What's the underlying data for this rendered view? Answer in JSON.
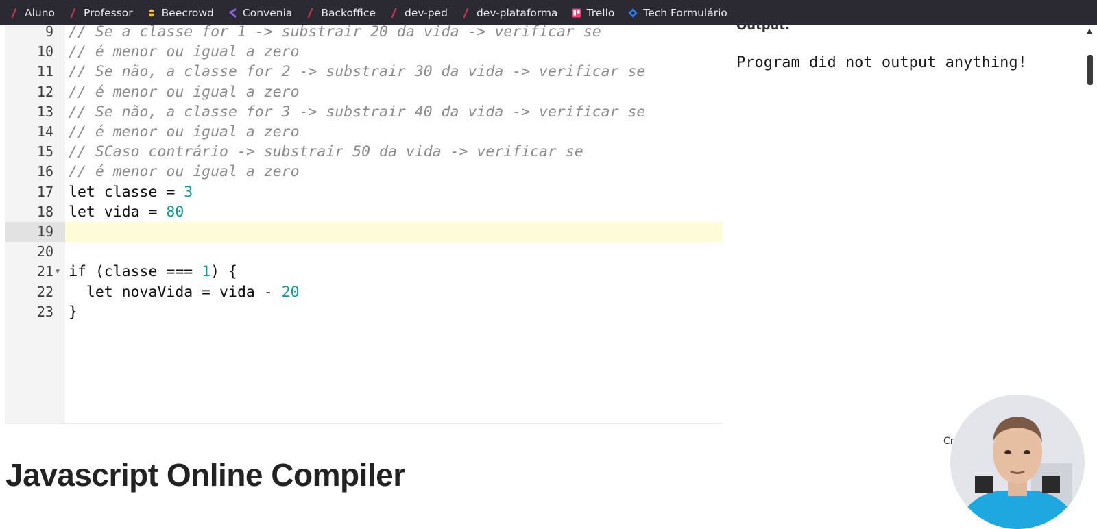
{
  "bookmarks": [
    {
      "label": "Aluno",
      "icon": "slash-icon",
      "color": "#c4374f"
    },
    {
      "label": "Professor",
      "icon": "slash-icon",
      "color": "#c4374f"
    },
    {
      "label": "Beecrowd",
      "icon": "beecrowd-icon",
      "color": "#f2c230"
    },
    {
      "label": "Convenia",
      "icon": "convenia-icon",
      "color": "#8e62d9"
    },
    {
      "label": "Backoffice",
      "icon": "slash-icon",
      "color": "#c4374f"
    },
    {
      "label": "dev-ped",
      "icon": "slash-icon",
      "color": "#c4374f"
    },
    {
      "label": "dev-plataforma",
      "icon": "slash-icon",
      "color": "#c4374f"
    },
    {
      "label": "Trello",
      "icon": "trello-icon",
      "color": "#e9457a"
    },
    {
      "label": "Tech Formulário",
      "icon": "jira-icon",
      "color": "#2684ff"
    }
  ],
  "editor": {
    "lines": [
      {
        "n": "9",
        "kind": "comment",
        "text": "// Se a classe for 1 -> substrair 20 da vida -> verificar se"
      },
      {
        "n": "10",
        "kind": "comment",
        "text": "// é menor ou igual a zero"
      },
      {
        "n": "11",
        "kind": "comment",
        "text": "// Se não, a classe for 2 -> substrair 30 da vida -> verificar se"
      },
      {
        "n": "12",
        "kind": "comment",
        "text": "// é menor ou igual a zero"
      },
      {
        "n": "13",
        "kind": "comment",
        "text": "// Se não, a classe for 3 -> substrair 40 da vida -> verificar se"
      },
      {
        "n": "14",
        "kind": "comment",
        "text": "// é menor ou igual a zero"
      },
      {
        "n": "15",
        "kind": "comment",
        "text": "// SCaso contrário -> substrair 50 da vida -> verificar se"
      },
      {
        "n": "16",
        "kind": "comment",
        "text": "// é menor ou igual a zero"
      },
      {
        "n": "17",
        "kind": "code",
        "pre": "let classe = ",
        "num": "3",
        "post": ""
      },
      {
        "n": "18",
        "kind": "code",
        "pre": "let vida = ",
        "num": "80",
        "post": ""
      },
      {
        "n": "19",
        "kind": "code",
        "pre": "",
        "num": "",
        "post": "",
        "active": true
      },
      {
        "n": "20",
        "kind": "code",
        "pre": "",
        "num": "",
        "post": ""
      },
      {
        "n": "21",
        "kind": "code",
        "pre": "if (classe === ",
        "num": "1",
        "post": ") {",
        "fold": true
      },
      {
        "n": "22",
        "kind": "code",
        "pre": "  let novaVida = vida - ",
        "num": "20",
        "post": ""
      },
      {
        "n": "23",
        "kind": "code",
        "pre": "}",
        "num": "",
        "post": ""
      }
    ]
  },
  "output": {
    "title": "Output:",
    "text": "Program did not output anything!"
  },
  "page": {
    "heading": "Javascript Online Compiler",
    "side_text": "Cr"
  },
  "colors": {
    "comment": "#8a8a8a",
    "number": "#0b9a9a",
    "active_line": "#fefcd6",
    "bookmark_bar": "#2b2a33"
  }
}
